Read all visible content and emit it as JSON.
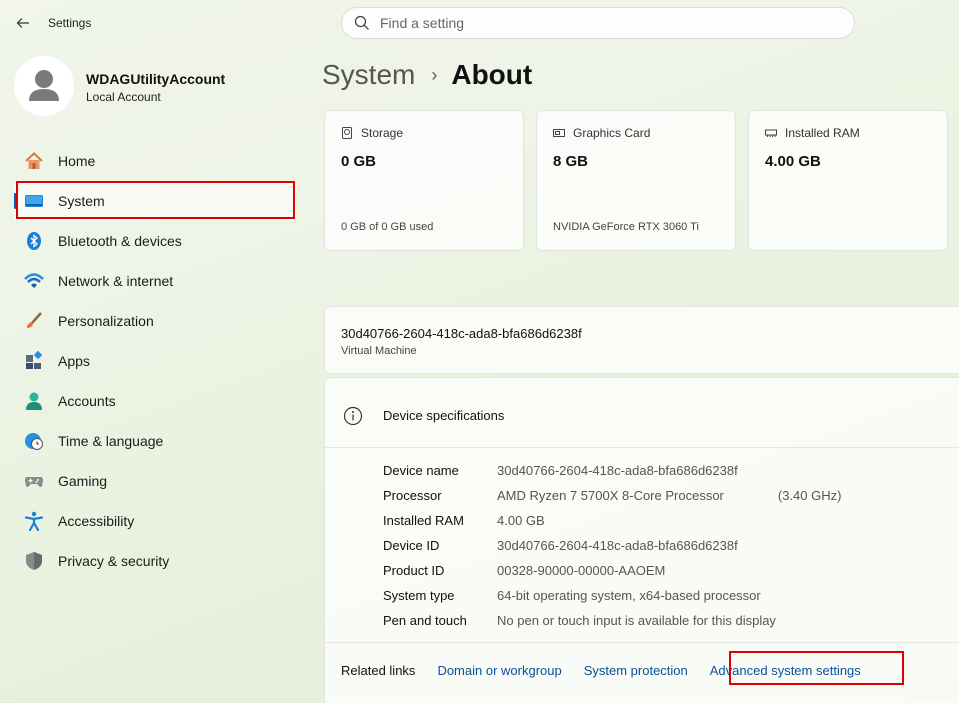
{
  "app": {
    "title": "Settings"
  },
  "search": {
    "placeholder": "Find a setting"
  },
  "account": {
    "name": "WDAGUtilityAccount",
    "type": "Local Account"
  },
  "sidebar": {
    "items": [
      {
        "label": "Home",
        "icon": "home-icon"
      },
      {
        "label": "System",
        "icon": "system-icon",
        "selected": true
      },
      {
        "label": "Bluetooth & devices",
        "icon": "bluetooth-icon"
      },
      {
        "label": "Network & internet",
        "icon": "wifi-icon"
      },
      {
        "label": "Personalization",
        "icon": "brush-icon"
      },
      {
        "label": "Apps",
        "icon": "apps-icon"
      },
      {
        "label": "Accounts",
        "icon": "accounts-icon"
      },
      {
        "label": "Time & language",
        "icon": "clock-globe-icon"
      },
      {
        "label": "Gaming",
        "icon": "gamepad-icon"
      },
      {
        "label": "Accessibility",
        "icon": "accessibility-icon"
      },
      {
        "label": "Privacy & security",
        "icon": "shield-icon"
      }
    ]
  },
  "breadcrumb": {
    "parent": "System",
    "separator": "›",
    "current": "About"
  },
  "cards": {
    "storage": {
      "title": "Storage",
      "value": "0 GB",
      "sub": "0 GB of 0 GB used"
    },
    "graphics": {
      "title": "Graphics Card",
      "value": "8 GB",
      "sub": "NVIDIA GeForce RTX 3060 Ti"
    },
    "ram": {
      "title": "Installed RAM",
      "value": "4.00 GB",
      "sub": ""
    }
  },
  "device": {
    "name": "30d40766-2604-418c-ada8-bfa686d6238f",
    "type": "Virtual Machine"
  },
  "specs": {
    "header": "Device specifications",
    "rows": [
      {
        "key": "Device name",
        "value": "30d40766-2604-418c-ada8-bfa686d6238f",
        "extra": ""
      },
      {
        "key": "Processor",
        "value": "AMD Ryzen 7 5700X 8-Core Processor",
        "extra": "(3.40 GHz)"
      },
      {
        "key": "Installed RAM",
        "value": "4.00 GB",
        "extra": ""
      },
      {
        "key": "Device ID",
        "value": "30d40766-2604-418c-ada8-bfa686d6238f",
        "extra": ""
      },
      {
        "key": "Product ID",
        "value": "00328-90000-00000-AAOEM",
        "extra": ""
      },
      {
        "key": "System type",
        "value": "64-bit operating system, x64-based processor",
        "extra": ""
      },
      {
        "key": "Pen and touch",
        "value": "No pen or touch input is available for this display",
        "extra": ""
      }
    ]
  },
  "related": {
    "label": "Related links",
    "links": [
      "Domain or workgroup",
      "System protection",
      "Advanced system settings"
    ]
  },
  "colors": {
    "accent": "#005fb8",
    "highlight": "#e00000",
    "link": "#0a4f9e"
  }
}
